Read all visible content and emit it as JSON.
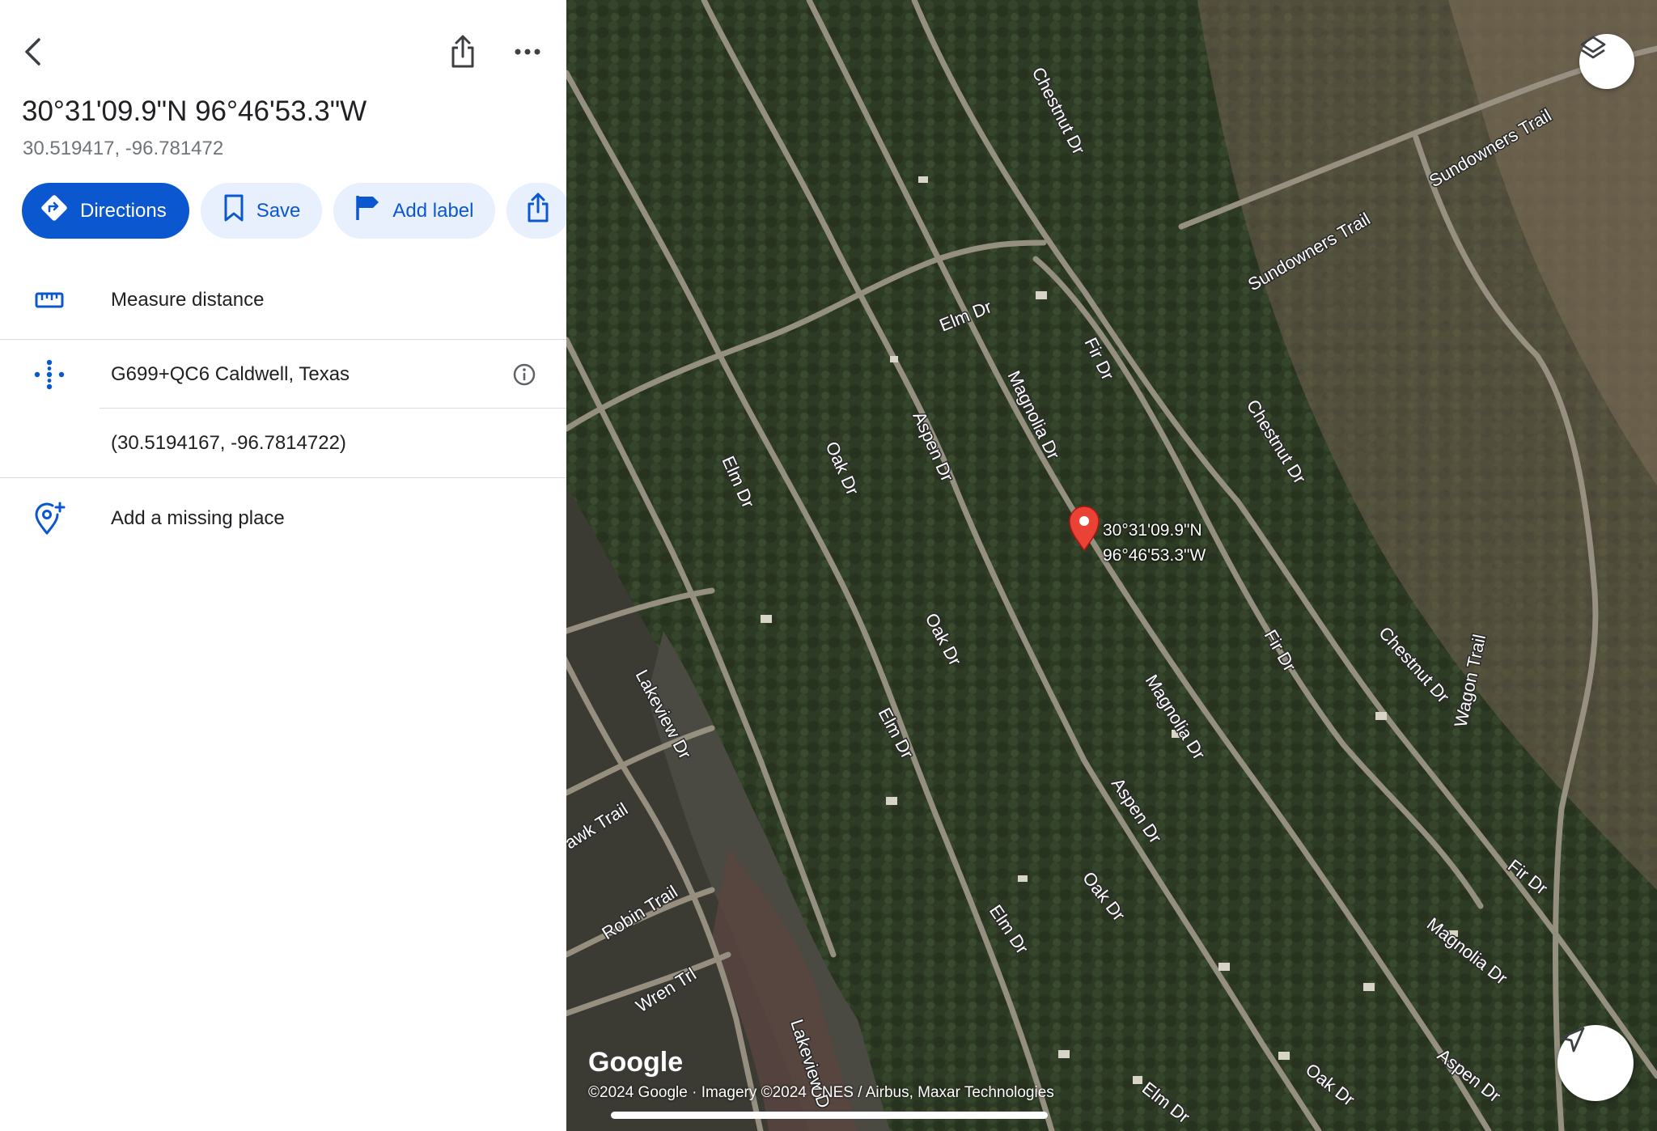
{
  "panel": {
    "title": "30°31'09.9\"N 96°46'53.3\"W",
    "decimal_coords": "30.519417, -96.781472",
    "actions": {
      "directions": "Directions",
      "save": "Save",
      "add_label": "Add label"
    },
    "rows": {
      "measure": "Measure distance",
      "plus_code": "G699+QC6 Caldwell, Texas",
      "precise_coords": "(30.5194167, -96.7814722)",
      "add_place": "Add a missing place"
    },
    "icons": [
      "back-icon",
      "share-icon",
      "more-icon",
      "directions-icon",
      "bookmark-icon",
      "flag-icon",
      "ruler-icon",
      "plus-code-icon",
      "info-icon",
      "add-place-icon"
    ]
  },
  "map": {
    "pin_label_line1": "30°31'09.9\"N",
    "pin_label_line2": "96°46'53.3\"W",
    "logo": "Google",
    "attribution": "©2024 Google · Imagery ©2024 CNES / Airbus, Maxar Technologies",
    "roads": {
      "chestnut": "Chestnut Dr",
      "sundowners": "Sundowners Trail",
      "elm": "Elm Dr",
      "fir": "Fir Dr",
      "magnolia": "Magnolia Dr",
      "aspen": "Aspen Dr",
      "oak": "Oak Dr",
      "lakeview": "Lakeview Dr",
      "lakeview_short": "Lakeview D",
      "wagon": "Wagon Trail",
      "hawk": "awk Trail",
      "robin": "Robin Trail",
      "wren": "Wren Trl"
    },
    "colors": {
      "pin": "#ea4335",
      "accent": "#0b57d0"
    }
  }
}
